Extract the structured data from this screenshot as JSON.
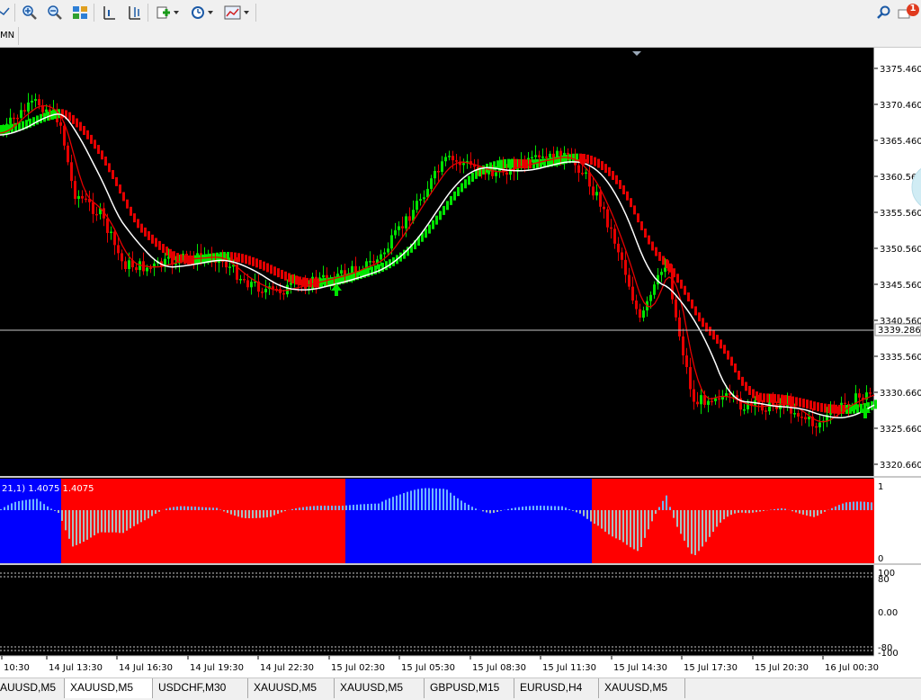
{
  "toolbar": {
    "icons": [
      "chart-line-icon",
      "zoom-in-icon",
      "zoom-out-icon",
      "tile-windows-icon",
      "period-separator-icon",
      "chart-shift-icon",
      "indicators-icon",
      "clock-icon",
      "templates-icon",
      "search-icon",
      "messages-icon"
    ],
    "notification_count": "1"
  },
  "timeframes": {
    "visible_label": "MN"
  },
  "main_chart": {
    "price_labels": [
      "3375.460",
      "3370.460",
      "3365.460",
      "3360.560",
      "3355.560",
      "3350.560",
      "3345.560",
      "3340.560",
      "3335.560",
      "3330.660",
      "3325.660",
      "3320.660"
    ],
    "current_price": "3339.286",
    "time_labels": [
      "10:30",
      "14 Jul 13:30",
      "14 Jul 16:30",
      "14 Jul 19:30",
      "14 Jul 22:30",
      "15 Jul 02:30",
      "15 Jul 05:30",
      "15 Jul 08:30",
      "15 Jul 11:30",
      "15 Jul 14:30",
      "15 Jul 17:30",
      "15 Jul 20:30",
      "16 Jul 00:30"
    ],
    "colors": {
      "bull": "#00e400",
      "bear": "#e60000",
      "ma_fast": "#e60000",
      "ma_slow": "#ffffff",
      "arrow_up": "#00e400",
      "arrow_down": "#e60000"
    }
  },
  "indicator1": {
    "label": "21,1) 1.4075 1.4075",
    "scale_top": "1",
    "scale_bottom": "0",
    "colors": {
      "blue": "#0000ff",
      "red": "#ff0000",
      "bar_pos": "#6fb6ff",
      "bar_neg": "#a8c0c0"
    }
  },
  "indicator2": {
    "scale_labels": [
      "100",
      "80",
      "0.00",
      "-80",
      "-100"
    ]
  },
  "tabs": [
    {
      "label": "AUUSD,M5"
    },
    {
      "label": "XAUUSD,M5"
    },
    {
      "label": "USDCHF,M30"
    },
    {
      "label": "XAUUSD,M5"
    },
    {
      "label": "XAUUSD,M5"
    },
    {
      "label": "GBPUSD,M15"
    },
    {
      "label": "EURUSD,H4"
    },
    {
      "label": "XAUUSD,M5"
    }
  ]
}
